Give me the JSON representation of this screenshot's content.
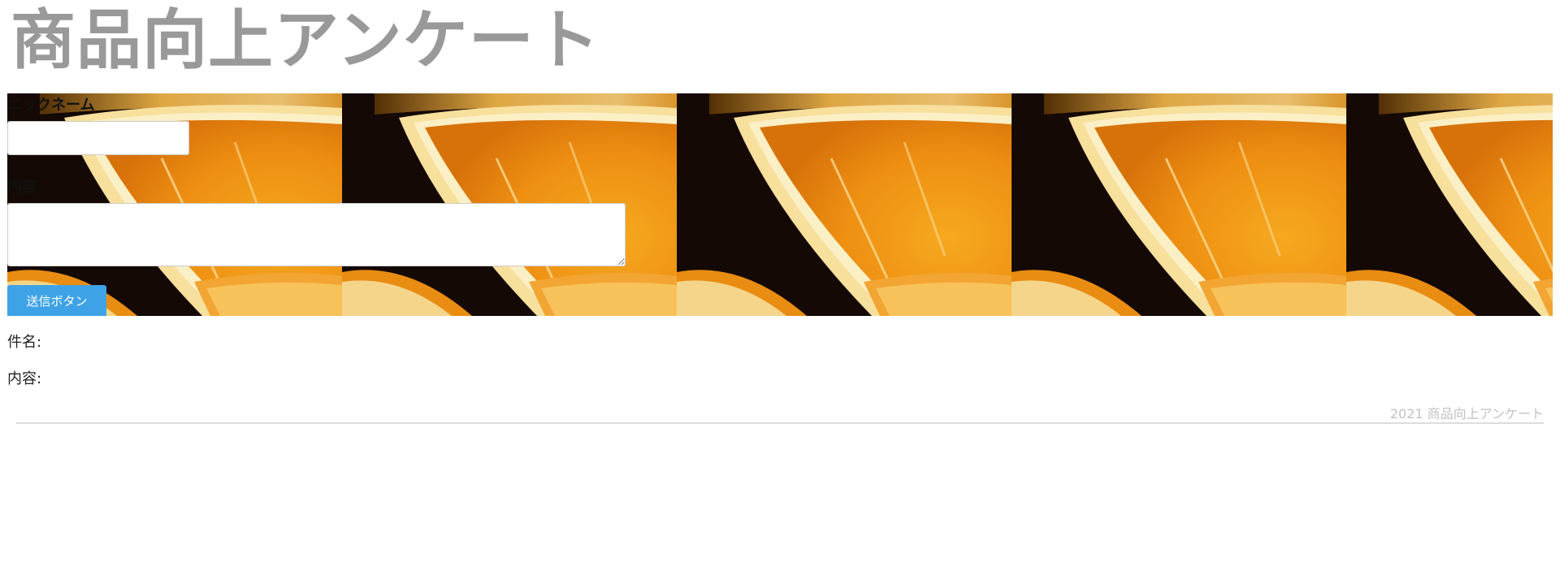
{
  "page": {
    "title": "商品向上アンケート"
  },
  "form": {
    "nickname_label": "ニックネーム",
    "nickname_value": "",
    "content_label": "内容",
    "content_value": "",
    "submit_label": "送信ボタン"
  },
  "result": {
    "subject_label": "件名:",
    "content_label": "内容:"
  },
  "footer": {
    "text": "2021 商品向上アンケート"
  },
  "banner": {
    "image": "orange-slices-photo",
    "tile_count": 5
  },
  "colors": {
    "title": "#999999",
    "button": "#3ea3e6",
    "footer_text": "#c2c2c2",
    "orange": "#f29a1c",
    "rind": "#f5e3a8"
  }
}
